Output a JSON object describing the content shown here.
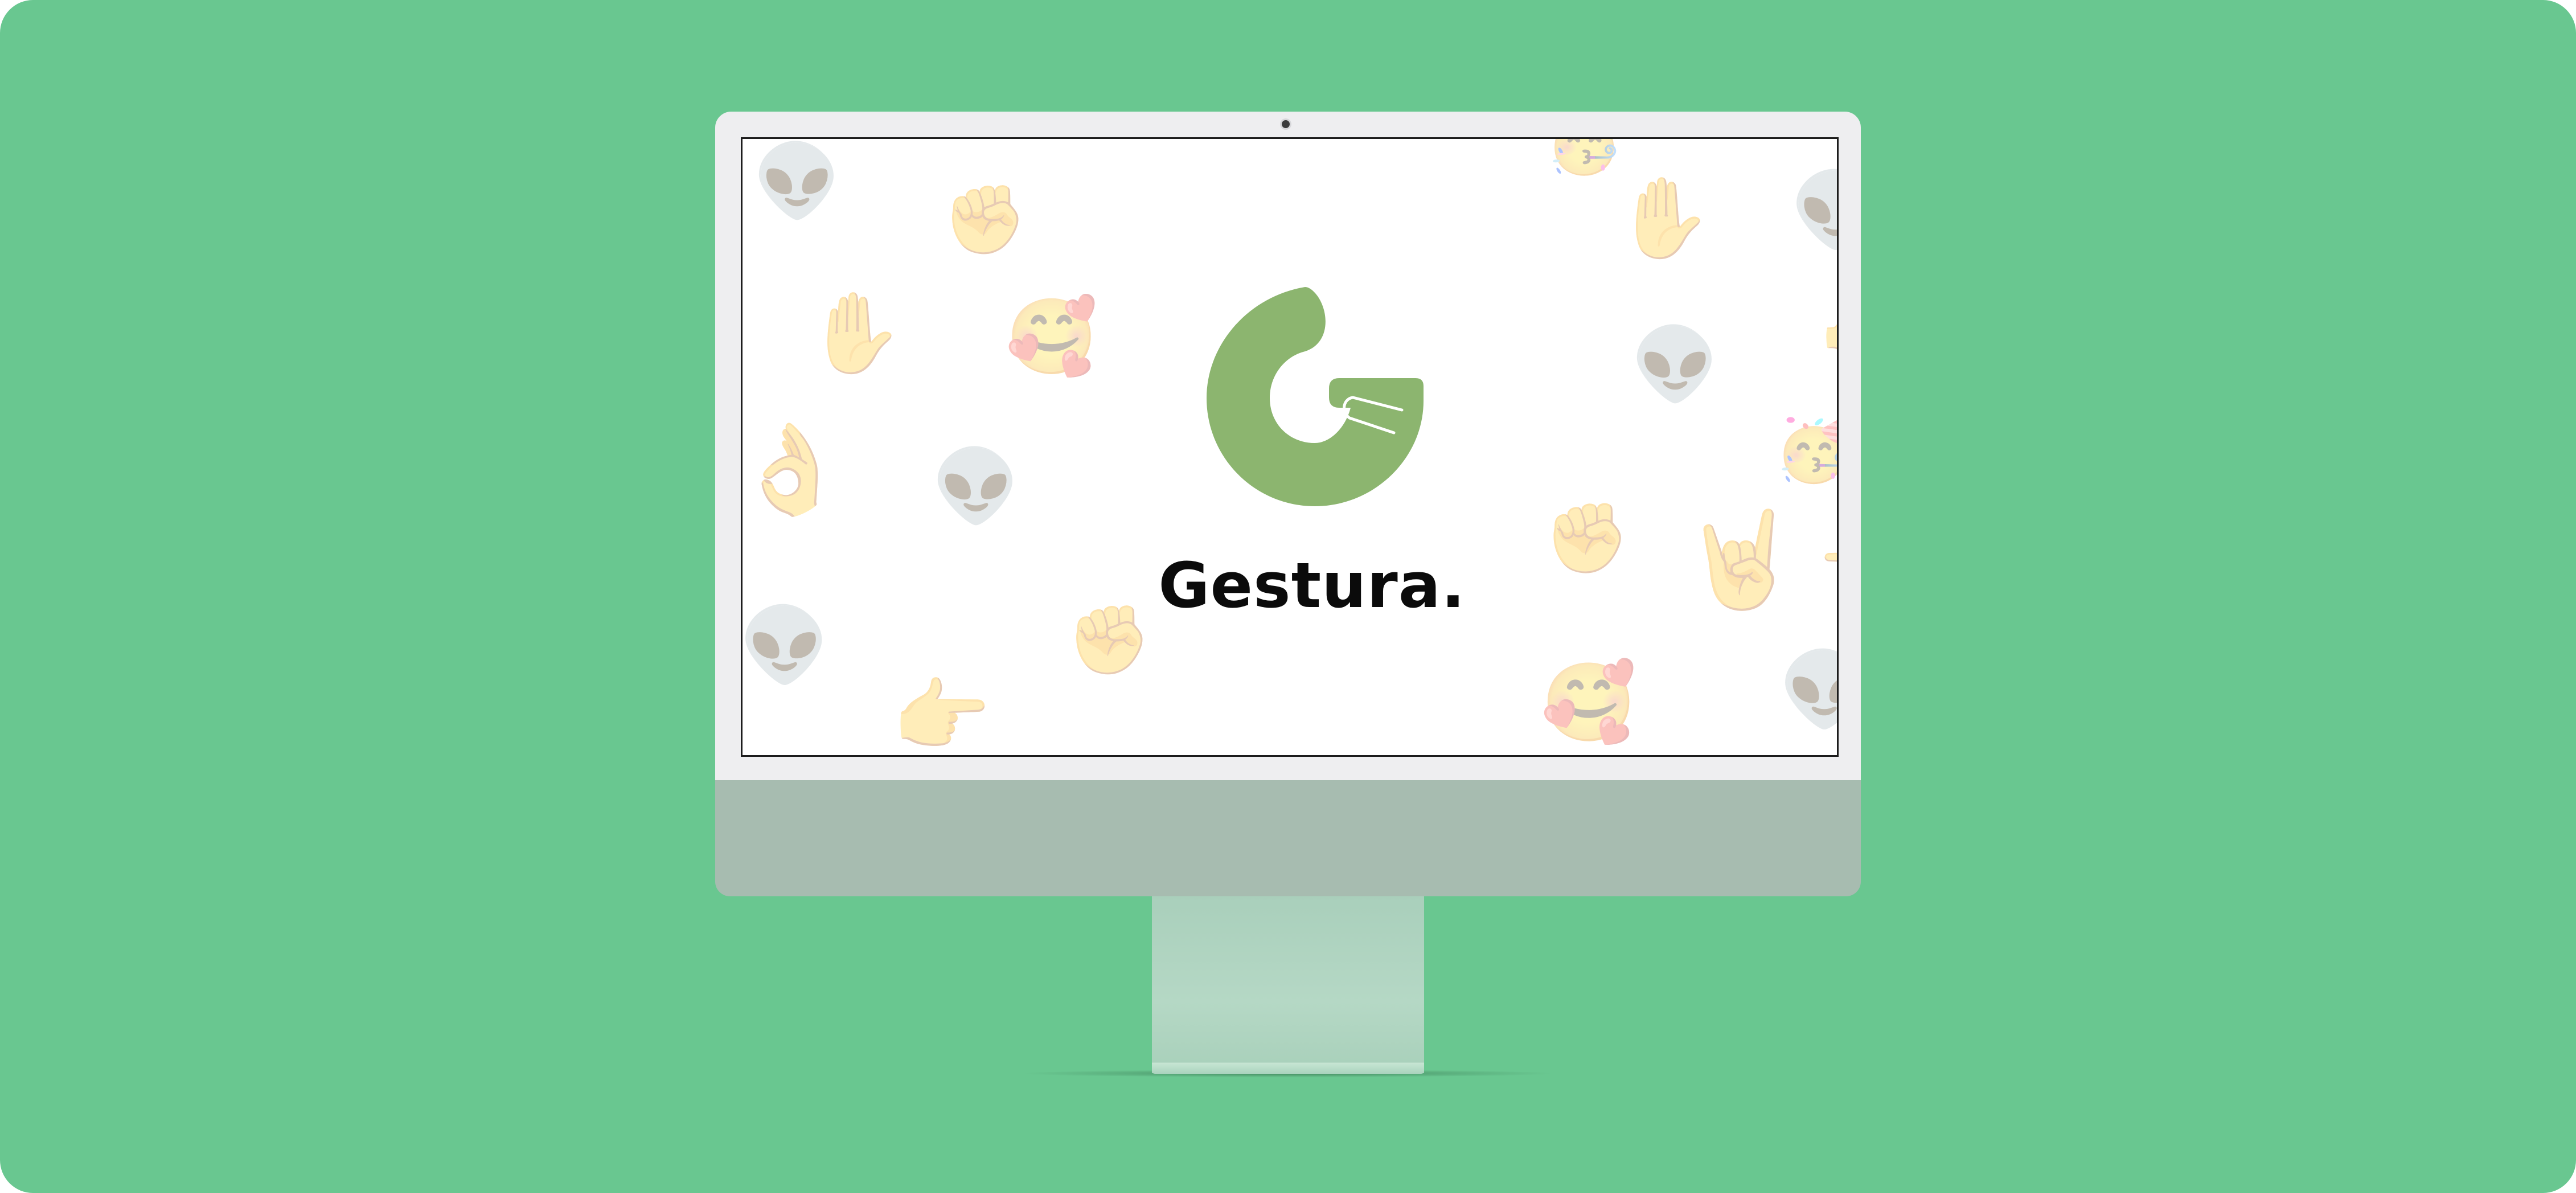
{
  "background_color": "#69c790",
  "device": {
    "type": "imac",
    "frame_color": "#eeeef0",
    "chin_color": "#a7bcb0",
    "stand_color": "#b5d8c5"
  },
  "screen": {
    "brand": {
      "name": "Gestura.",
      "logo_icon": "gestura-g-hand-logo",
      "logo_color": "#8cb56f"
    },
    "emojis": [
      {
        "icon": "alien-emoji",
        "char": "👽"
      },
      {
        "icon": "raised-fist-emoji",
        "char": "✊"
      },
      {
        "icon": "raised-hand-emoji",
        "char": "✋"
      },
      {
        "icon": "smiling-face-with-hearts-emoji",
        "char": "🥰"
      },
      {
        "icon": "ok-hand-emoji",
        "char": "👌"
      },
      {
        "icon": "alien-emoji",
        "char": "👽"
      },
      {
        "icon": "alien-emoji",
        "char": "👽"
      },
      {
        "icon": "raised-fist-emoji",
        "char": "✊"
      },
      {
        "icon": "pointing-hand-emoji",
        "char": "👉"
      },
      {
        "icon": "raised-hand-emoji",
        "char": "✋"
      },
      {
        "icon": "alien-emoji",
        "char": "👽"
      },
      {
        "icon": "alien-emoji",
        "char": "👽"
      },
      {
        "icon": "partying-face-emoji",
        "char": "🥳"
      },
      {
        "icon": "raised-fist-emoji",
        "char": "✊"
      },
      {
        "icon": "sign-of-the-horns-emoji",
        "char": "🤘"
      },
      {
        "icon": "smiling-face-with-hearts-emoji",
        "char": "🥰"
      },
      {
        "icon": "alien-emoji",
        "char": "👽"
      },
      {
        "icon": "partying-face-emoji",
        "char": "🥳"
      },
      {
        "icon": "hand-edge-emoji",
        "char": "🤙"
      },
      {
        "icon": "hand-edge-emoji",
        "char": "👈"
      }
    ]
  }
}
